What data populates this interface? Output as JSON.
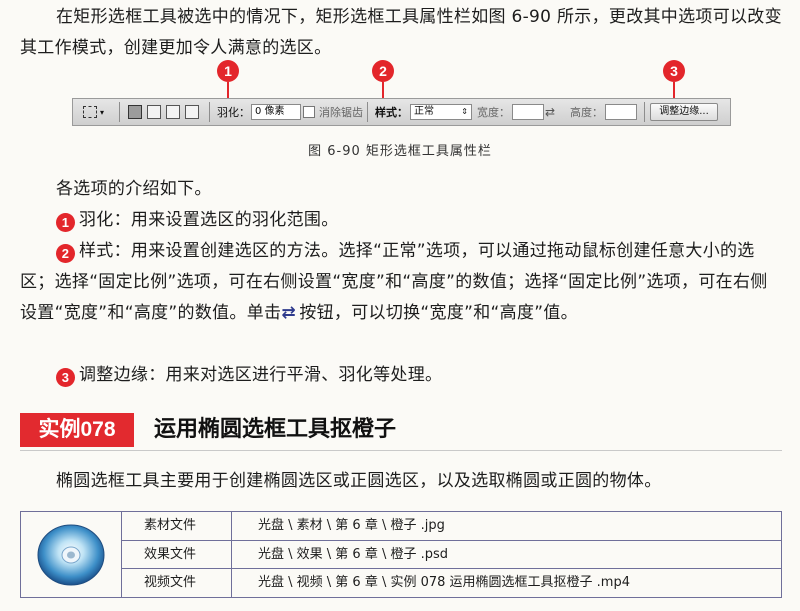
{
  "intro_text": "在矩形选框工具被选中的情况下，矩形选框工具属性栏如图 6-90 所示，更改其中选项可以改变其工作模式，创建更加令人满意的选区。",
  "figure": {
    "callouts": [
      "1",
      "2",
      "3"
    ],
    "toolbar": {
      "feather_label": "羽化：",
      "feather_value": "0 像素",
      "antialias_label": "消除锯齿",
      "style_label": "样式：",
      "style_value": "正常",
      "width_label": "宽度：",
      "height_label": "高度：",
      "refine_button": "调整边缘..."
    },
    "caption": "图 6-90    矩形选框工具属性栏"
  },
  "options_intro": "各选项的介绍如下。",
  "options": [
    {
      "num": "1",
      "text": "羽化：用来设置选区的羽化范围。"
    },
    {
      "num": "2",
      "text_before": "样式：用来设置创建选区的方法。选择“正常”选项，可以通过拖动鼠标创建任意大小的选区；选择“固定比例”选项，可在右侧设置“宽度”和“高度”的数值；选择“固定比例”选项，可在右侧设置“宽度”和“高度”的数值。单击",
      "text_after": "按钮，可以切换“宽度”和“高度”值。"
    },
    {
      "num": "3",
      "text": "调整边缘：用来对选区进行平滑、羽化等处理。"
    }
  ],
  "section": {
    "badge": "实例078",
    "title": "运用椭圆选框工具抠橙子",
    "description": "椭圆选框工具主要用于创建椭圆选区或正圆选区，以及选取椭圆或正圆的物体。"
  },
  "file_table": [
    {
      "label": "素材文件",
      "path": "光盘 \\ 素材 \\ 第 6 章 \\ 橙子 .jpg"
    },
    {
      "label": "效果文件",
      "path": "光盘 \\ 效果 \\ 第 6 章 \\ 橙子 .psd"
    },
    {
      "label": "视频文件",
      "path": "光盘 \\ 视频 \\ 第 6 章 \\ 实例 078    运用椭圆选框工具抠橙子 .mp4"
    }
  ],
  "colors": {
    "accent_red": "#e3262b",
    "table_border": "#6f6f9a"
  },
  "icons": [
    "marquee-icon",
    "swap-icon",
    "cd-disc-icon"
  ]
}
